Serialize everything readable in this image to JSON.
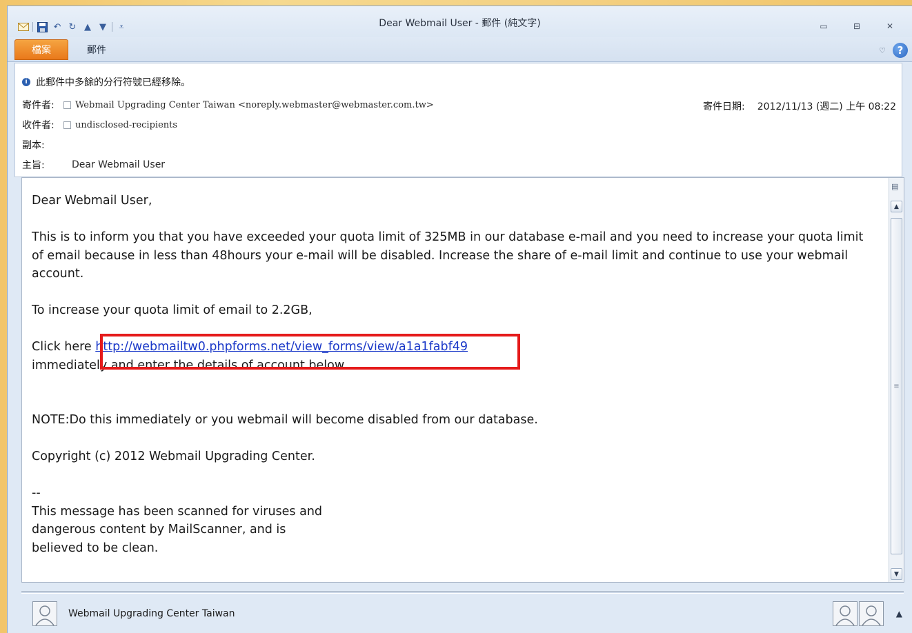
{
  "window": {
    "title": "Dear Webmail User - 郵件 (純文字)",
    "controls": {
      "minimize": "▭",
      "restore": "⊟",
      "close": "✕"
    }
  },
  "ribbon": {
    "tabs": [
      {
        "label": "檔案"
      },
      {
        "label": "郵件"
      }
    ]
  },
  "header": {
    "info": "此郵件中多餘的分行符號已經移除。",
    "from_label": "寄件者:",
    "from_value": "Webmail Upgrading Center Taiwan <noreply.webmaster@webmaster.com.tw>",
    "to_label": "收件者:",
    "to_value": "undisclosed-recipients",
    "cc_label": "副本:",
    "subject_label": "主旨:",
    "subject_value": "Dear Webmail User",
    "date_label": "寄件日期:",
    "date_value": "2012/11/13 (週二) 上午 08:22"
  },
  "message": {
    "greeting": "Dear Webmail User,",
    "para1": "This is to inform you that you have exceeded your quota limit of 325MB in our database e-mail and you need to increase your quota limit of email because in less than 48hours your e-mail will be disabled. Increase the share of e-mail limit and continue to use your webmail account.",
    "para2": "To increase your quota limit of email to 2.2GB,",
    "click_prefix": "Click here ",
    "link": "http://webmailtw0.phpforms.net/view_forms/view/a1a1fabf49",
    "click_suffix": "immediately and enter the details of account below.",
    "note": "NOTE:Do this immediately or you webmail will become disabled from our database.",
    "copyright": "Copyright (c) 2012 Webmail Upgrading Center.",
    "sig_sep": "--",
    "sig_line1": "This message has been scanned for viruses and",
    "sig_line2": "dangerous content by MailScanner, and is",
    "sig_line3": "believed to be clean."
  },
  "footer": {
    "sender_name": "Webmail Upgrading Center Taiwan"
  },
  "colors": {
    "file_tab": "#e9791b",
    "link": "#1a38c8",
    "highlight_box": "#e51a1a"
  }
}
